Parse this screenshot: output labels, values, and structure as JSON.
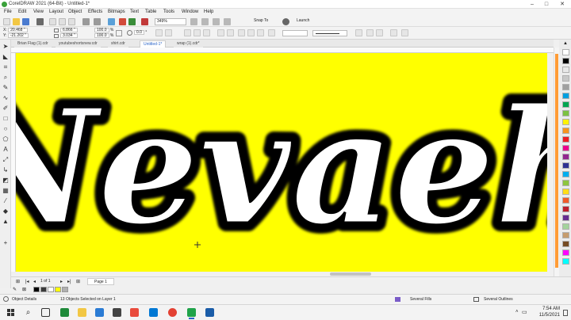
{
  "window": {
    "title": "CorelDRAW 2021 (64-Bit) - Untitled-1*",
    "controls": {
      "minimize": "–",
      "maximize": "□",
      "close": "✕"
    }
  },
  "menu": [
    "File",
    "Edit",
    "View",
    "Layout",
    "Object",
    "Effects",
    "Bitmaps",
    "Text",
    "Table",
    "Tools",
    "Window",
    "Help"
  ],
  "toolbar": {
    "zoom": "349%",
    "snap_to": "Snap To",
    "launch": "Launch"
  },
  "property_bar": {
    "x_label": "X:",
    "x": "20.468 \"",
    "y_label": "Y:",
    "y": "-21.202 \"",
    "width": "6.866 \"",
    "height": "3.034 \"",
    "scale_x": "100.0",
    "scale_y": "100.0",
    "pct": "%",
    "rotation": "0.0",
    "deg": "°"
  },
  "tabs": [
    {
      "label": "Brian Flag (1).cdr",
      "active": false
    },
    {
      "label": "youtubeshortsnew.cdr",
      "active": false
    },
    {
      "label": "shirt.cdr",
      "active": false
    },
    {
      "label": "Untitled-1*",
      "active": true
    },
    {
      "label": "wrap (1).cdr*",
      "active": false
    }
  ],
  "canvas": {
    "text": "Nevaeh",
    "background": "#ffff00",
    "fill": "#ffffff",
    "outline": "#000000"
  },
  "page_nav": {
    "current": "1",
    "of": "of",
    "total": "1",
    "page_tab": "Page 1"
  },
  "status": {
    "object_details": "Object Details",
    "selection": "13 Objects Selected on Layer 1",
    "fill": "Several Fills",
    "outline": "Several Outlines"
  },
  "clock": {
    "time": "7:54 AM",
    "date": "11/5/2021"
  },
  "palette": [
    "#ffffff",
    "#000000",
    "#e8e8e8",
    "#c8c8c8",
    "#a0a0a0",
    "#00a0e0",
    "#00a651",
    "#7cc242",
    "#fff200",
    "#f7941d",
    "#ed1c24",
    "#ec008c",
    "#92278f",
    "#2e3192",
    "#00aeef",
    "#8dc63f",
    "#ffde17",
    "#f15a29",
    "#be1e2d",
    "#662d91",
    "#a3d39c",
    "#c69c6d",
    "#754c24",
    "#ff00ff",
    "#00ffff"
  ],
  "docker_swatches": [
    "#000000",
    "#3a3a3a",
    "#ffffff",
    "#ffff00",
    "#b0b0b0"
  ]
}
